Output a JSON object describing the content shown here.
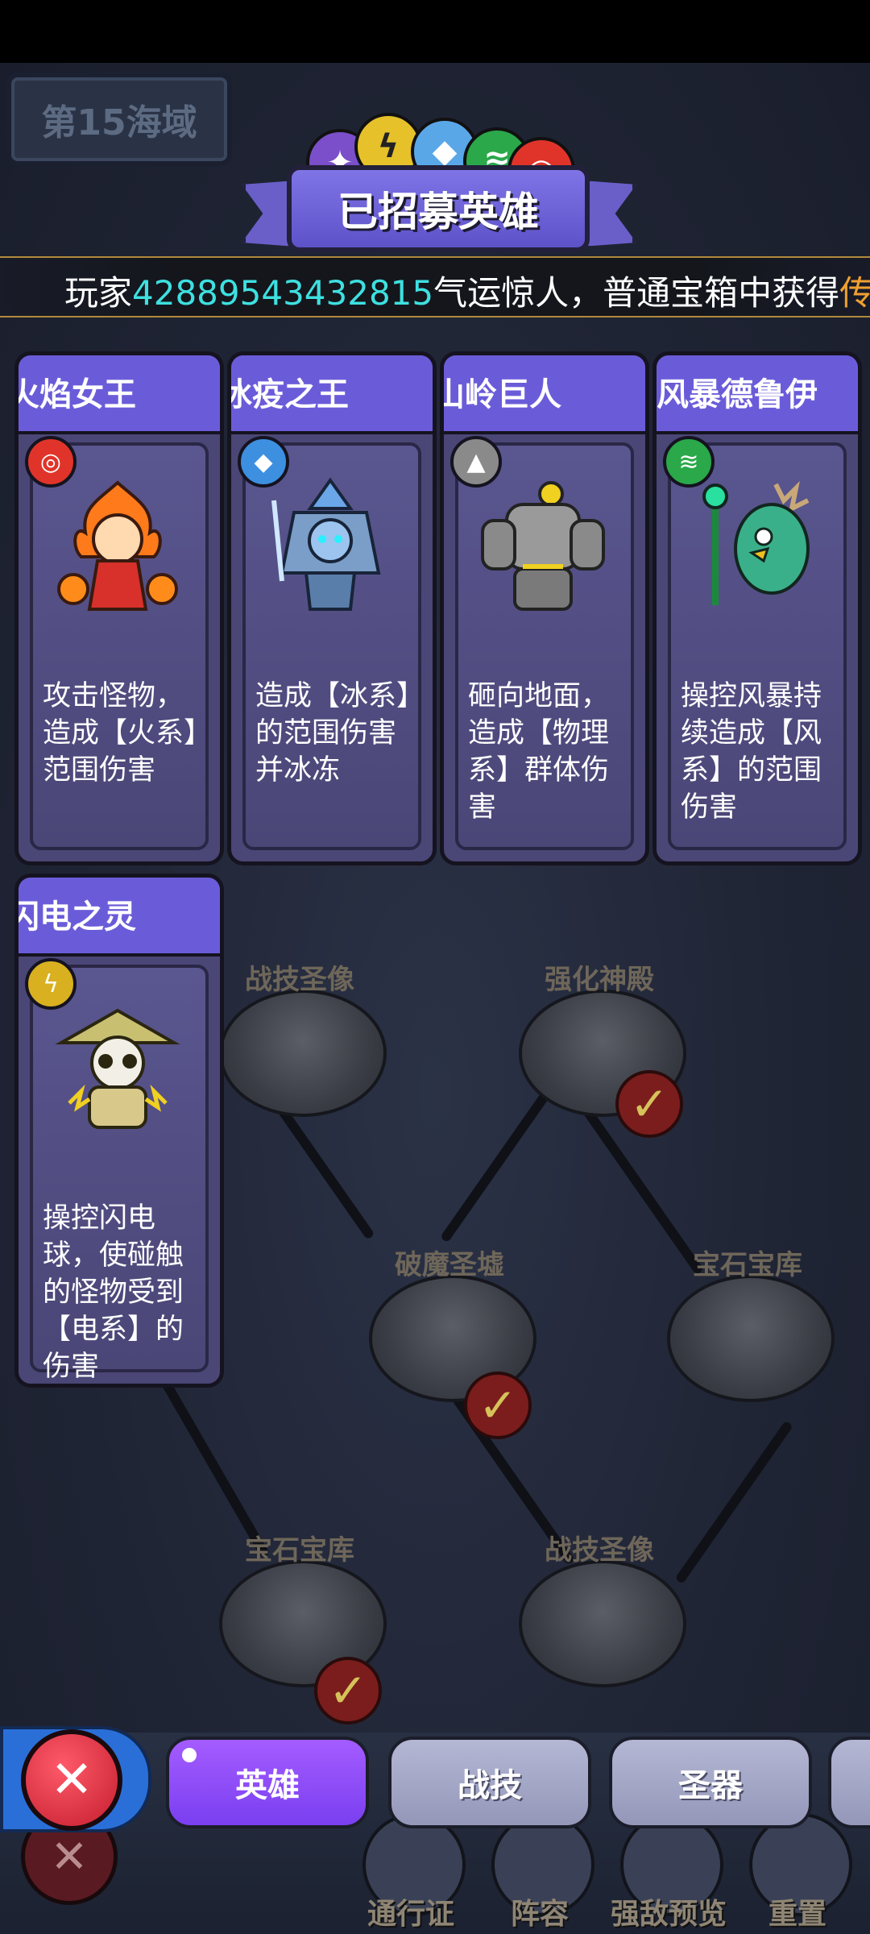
{
  "region": {
    "label": "第15海域"
  },
  "title": "已招募英雄",
  "ticker": {
    "prefix": "玩家",
    "player_id": "42889543432815",
    "middle": "气运惊人，普通宝箱中获得",
    "tail": "传"
  },
  "map_nodes": [
    {
      "label": "战技圣像",
      "checked": false
    },
    {
      "label": "强化神殿",
      "checked": true
    },
    {
      "label": "破魔圣墟",
      "checked": true
    },
    {
      "label": "宝石宝库",
      "checked": false
    },
    {
      "label": "宝石宝库",
      "checked": true
    },
    {
      "label": "战技圣像",
      "checked": false
    }
  ],
  "heroes": [
    {
      "name": "火焰女王",
      "element_icon": "fire-element-icon",
      "element_color": "#e0342a",
      "desc": "攻击怪物，造成【火系】范围伤害"
    },
    {
      "name": "冰疫之王",
      "element_icon": "ice-element-icon",
      "element_color": "#3d8fe0",
      "desc": "造成【冰系】的范围伤害并冰冻"
    },
    {
      "name": "山岭巨人",
      "element_icon": "rock-element-icon",
      "element_color": "#8a8a8a",
      "desc": "砸向地面，造成【物理系】群体伤害"
    },
    {
      "name": "风暴德鲁伊",
      "element_icon": "wind-element-icon",
      "element_color": "#2aa84a",
      "desc": "操控风暴持续造成【风系】的范围伤害"
    },
    {
      "name": "闪电之灵",
      "element_icon": "lightning-element-icon",
      "element_color": "#d8b020",
      "desc": "操控闪电球，使碰触的怪物受到【电系】的伤害"
    }
  ],
  "tabs": [
    {
      "label": "英雄",
      "active": true
    },
    {
      "label": "战技",
      "active": false
    },
    {
      "label": "圣器",
      "active": false
    }
  ],
  "bottom_nav": [
    {
      "label": "通行证",
      "icon": "pass-icon"
    },
    {
      "label": "阵容",
      "icon": "lineup-icon"
    },
    {
      "label": "强敌预览",
      "icon": "magnifier-icon"
    },
    {
      "label": "重置",
      "icon": "reset-icon"
    }
  ],
  "colors": {
    "accent": "#7a3ff0",
    "banner": "#6a5cd9",
    "ticker_highlight": "#3ee0e0",
    "ticker_gold": "#f0a030"
  }
}
